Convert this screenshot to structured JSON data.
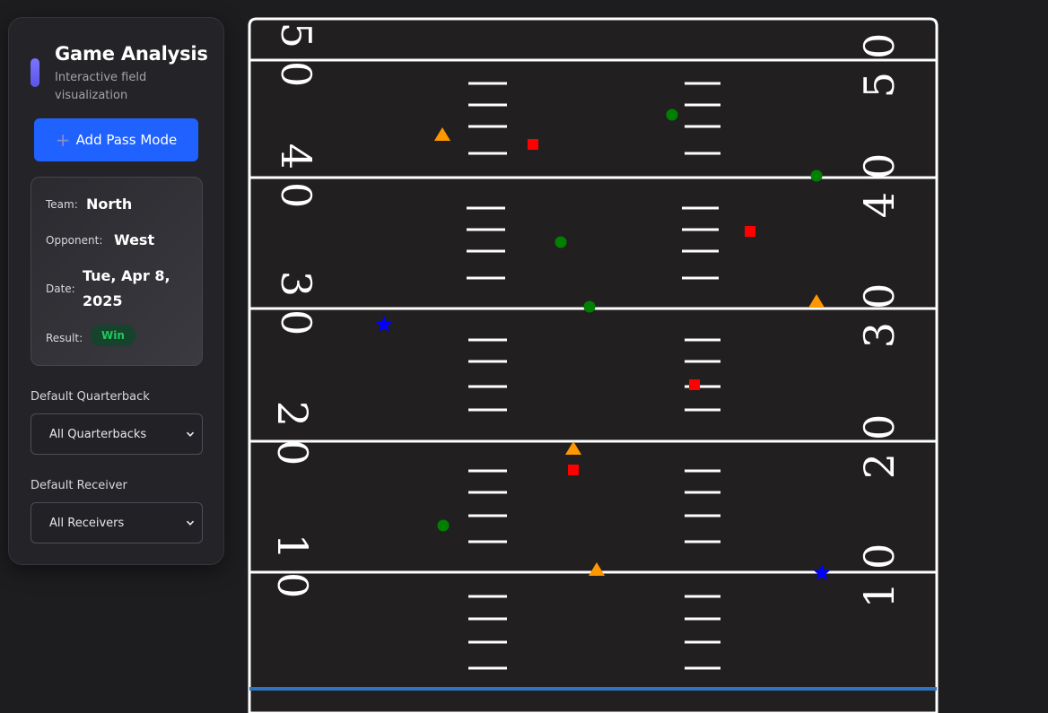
{
  "sidebar": {
    "title": "Game Analysis",
    "subtitle": "Interactive field visualization",
    "add_pass_button": "Add Pass Mode",
    "game_info": {
      "team_label": "Team:",
      "team": "North",
      "opponent_label": "Opponent:",
      "opponent": "West",
      "date_label": "Date:",
      "date_line1": "Tue, Apr 8,",
      "date_line2": "2025",
      "result_label": "Result:",
      "result": "Win"
    },
    "quarterback_label": "Default Quarterback",
    "quarterback_value": "All Quarterbacks",
    "receiver_label": "Default Receiver",
    "receiver_value": "All Receivers"
  },
  "field": {
    "yard_numbers": [
      "50",
      "40",
      "30",
      "20",
      "10"
    ],
    "markers": [
      {
        "shape": "triangle",
        "color": "#ff9800"
      },
      {
        "shape": "square",
        "color": "#ff0000"
      },
      {
        "shape": "circle",
        "color": "#008000"
      },
      {
        "shape": "circle",
        "color": "#008000"
      },
      {
        "shape": "circle",
        "color": "#008000"
      },
      {
        "shape": "square",
        "color": "#ff0000"
      },
      {
        "shape": "circle",
        "color": "#008000"
      },
      {
        "shape": "triangle",
        "color": "#ff9800"
      },
      {
        "shape": "star",
        "color": "#0000ff"
      },
      {
        "shape": "square",
        "color": "#ff0000"
      },
      {
        "shape": "triangle",
        "color": "#ff9800"
      },
      {
        "shape": "square",
        "color": "#ff0000"
      },
      {
        "shape": "circle",
        "color": "#008000"
      },
      {
        "shape": "triangle",
        "color": "#ff9800"
      },
      {
        "shape": "star",
        "color": "#0000ff"
      }
    ]
  },
  "colors": {
    "field_bg": "#221f20",
    "line": "#ffffff",
    "goal_line": "#2f74c0",
    "accent_button": "#1f62ff",
    "win_text": "#22c55e"
  }
}
